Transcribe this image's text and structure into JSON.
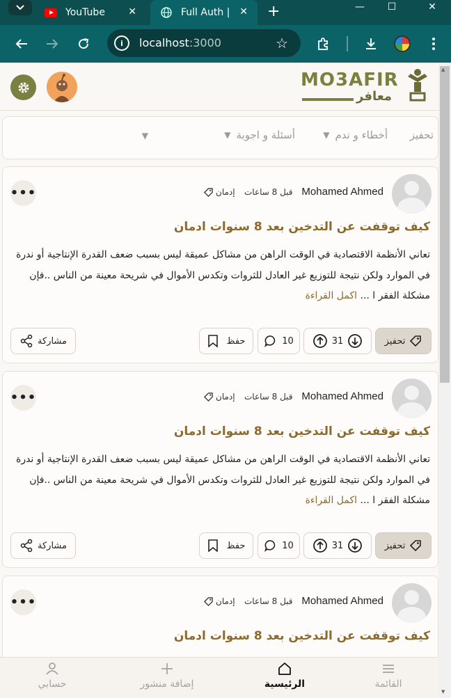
{
  "browser": {
    "tabs": [
      {
        "title": "YouTube",
        "icon": "youtube-icon"
      },
      {
        "title": "Full Auth |",
        "icon": "globe-icon",
        "active": true
      }
    ],
    "url_host": "localhost",
    "url_port": ":3000"
  },
  "header": {
    "logo_title": "MO3AFIR",
    "logo_subtitle": "معافر"
  },
  "categories": [
    {
      "label": "تحفيز"
    },
    {
      "label": "أخطاء و ندم"
    },
    {
      "label": "أسئلة و اجوبة"
    }
  ],
  "posts": [
    {
      "author": "Mohamed Ahmed",
      "time": "قبل 8 ساعات",
      "tag": "إدمان",
      "title": "كيف توقفت عن التدخين بعد 8 سنوات ادمان",
      "body": "تعاني الأنظمة الاقتصادية في الوقت الراهن من مشاكل عميقة ليس بسبب ضعف القدرة الإنتاجية أو ندرة في الموارد ولكن نتيجة للتوزيع غير العادل للثروات وتكدس الأموال في شريحة معينة من الناس ..فإن مشكلة الفقر ا ...",
      "read_more": "اكمل القراءة",
      "category": "تحفيز",
      "votes": "31",
      "comments": "10",
      "save_label": "حفظ",
      "share_label": "مشاركة"
    },
    {
      "author": "Mohamed Ahmed",
      "time": "قبل 8 ساعات",
      "tag": "إدمان",
      "title": "كيف توقفت عن التدخين بعد 8 سنوات ادمان",
      "body": "تعاني الأنظمة الاقتصادية في الوقت الراهن من مشاكل عميقة ليس بسبب ضعف القدرة الإنتاجية أو ندرة في الموارد ولكن نتيجة للتوزيع غير العادل للثروات وتكدس الأموال في شريحة معينة من الناس ..فإن مشكلة الفقر ا ...",
      "read_more": "اكمل القراءة",
      "category": "تحفيز",
      "votes": "31",
      "comments": "10",
      "save_label": "حفظ",
      "share_label": "مشاركة"
    },
    {
      "author": "Mohamed Ahmed",
      "time": "قبل 8 ساعات",
      "tag": "إدمان",
      "title": "كيف توقفت عن التدخين بعد 8 سنوات ادمان"
    }
  ],
  "bottom_nav": [
    {
      "label": "القائمة",
      "icon": "menu-icon"
    },
    {
      "label": "الرئيسية",
      "icon": "home-icon",
      "active": true
    },
    {
      "label": "إضافة منشور",
      "icon": "plus-icon"
    },
    {
      "label": "حسابي",
      "icon": "user-icon"
    }
  ],
  "colors": {
    "brand_teal": "#0b6367",
    "accent_olive": "#7a8040",
    "title_brown": "#8a6a2e"
  }
}
